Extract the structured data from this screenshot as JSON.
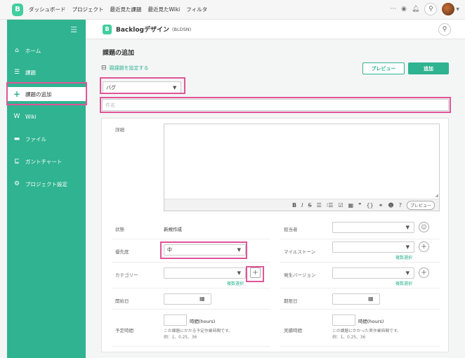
{
  "topnav": {
    "logo_text": "B",
    "items": [
      "ダッシュボード",
      "プロジェクト",
      "最近見た課題",
      "最近見たWiki",
      "フィルタ"
    ],
    "more": "···",
    "watch_icon": "eye-icon",
    "notif_icon": "bell-icon",
    "search_icon": "search-icon"
  },
  "sidebar": {
    "toggle": "☰",
    "items": [
      {
        "label": "ホーム",
        "icon": "home-icon",
        "glyph": "⌂"
      },
      {
        "label": "課題",
        "icon": "list-icon",
        "glyph": "☰"
      },
      {
        "label": "課題の追加",
        "icon": "plus-icon",
        "glyph": "+"
      },
      {
        "label": "Wiki",
        "icon": "wiki-icon",
        "glyph": "W"
      },
      {
        "label": "ファイル",
        "icon": "folder-icon",
        "glyph": "▬"
      },
      {
        "label": "ガントチャート",
        "icon": "gantt-icon",
        "glyph": "⊑"
      },
      {
        "label": "プロジェクト設定",
        "icon": "gear-icon",
        "glyph": "⚙"
      }
    ]
  },
  "project": {
    "icon_text": "B",
    "name": "Backlogデザイン",
    "key": "(BLDSN)"
  },
  "form": {
    "title": "課題の追加",
    "parent_link": "親課題を設定する",
    "preview_button": "プレビュー",
    "add_button": "追加",
    "issue_type": "バグ",
    "subject_placeholder": "件名",
    "description_label": "詳細",
    "toolbar": [
      "B",
      "I",
      "S",
      "☰",
      "⁝☰",
      "☑",
      "▦",
      "❞",
      "{}",
      "⚭",
      "☻",
      "?"
    ],
    "toolbar_preview": "プレビュー",
    "status_label": "状態",
    "status_value": "新規作成",
    "assignee_label": "担当者",
    "priority_label": "優先度",
    "priority_value": "中",
    "milestone_label": "マイルストーン",
    "multi_select": "複数選択",
    "category_label": "カテゴリー",
    "version_label": "発生バージョン",
    "start_label": "開始日",
    "due_label": "期限日",
    "estimated_label": "予定時間",
    "estimated_unit": "時間(hours)",
    "estimated_hint1": "この課題にかかる予定作業時間です。",
    "estimated_hint2": "例：1、0.25、36",
    "actual_label": "実績時間",
    "actual_unit": "時間(hours)",
    "actual_hint1": "この課題にかかった実作業時間です。",
    "actual_hint2": "例：1、0.25、36"
  },
  "colors": {
    "brand": "#2fb390",
    "highlight": "#e05598"
  }
}
